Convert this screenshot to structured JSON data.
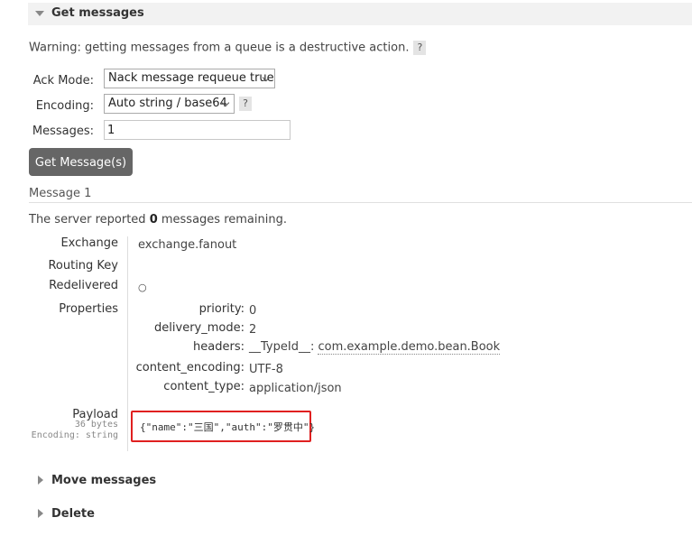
{
  "section": {
    "title": "Get messages"
  },
  "warning": {
    "text": "Warning: getting messages from a queue is a destructive action.",
    "help": "?"
  },
  "form": {
    "ack_mode_label": "Ack Mode:",
    "ack_mode_value": "Nack message requeue true",
    "encoding_label": "Encoding:",
    "encoding_value": "Auto string / base64",
    "encoding_help": "?",
    "messages_label": "Messages:",
    "messages_value": "1",
    "get_button": "Get Message(s)"
  },
  "message": {
    "heading": "Message 1",
    "server_prefix": "The server reported ",
    "remaining_count": "0",
    "server_suffix": " messages remaining.",
    "fields": {
      "exchange_label": "Exchange",
      "exchange_value": "exchange.fanout",
      "routing_key_label": "Routing Key",
      "redelivered_label": "Redelivered",
      "redelivered_value": "○",
      "properties_label": "Properties"
    },
    "properties": {
      "priority_label": "priority:",
      "priority_value": "0",
      "delivery_mode_label": "delivery_mode:",
      "delivery_mode_value": "2",
      "headers_label": "headers:",
      "headers_key": "__TypeId__:",
      "headers_value": "com.example.demo.bean.Book",
      "content_encoding_label": "content_encoding:",
      "content_encoding_value": "UTF-8",
      "content_type_label": "content_type:",
      "content_type_value": "application/json"
    },
    "payload": {
      "label": "Payload",
      "size": "36 bytes",
      "encoding": "Encoding: string",
      "body": "{\"name\":\"三国\",\"auth\":\"罗贯中\"}"
    }
  },
  "collapsed_sections": [
    {
      "label": "Move messages"
    },
    {
      "label": "Delete"
    }
  ]
}
